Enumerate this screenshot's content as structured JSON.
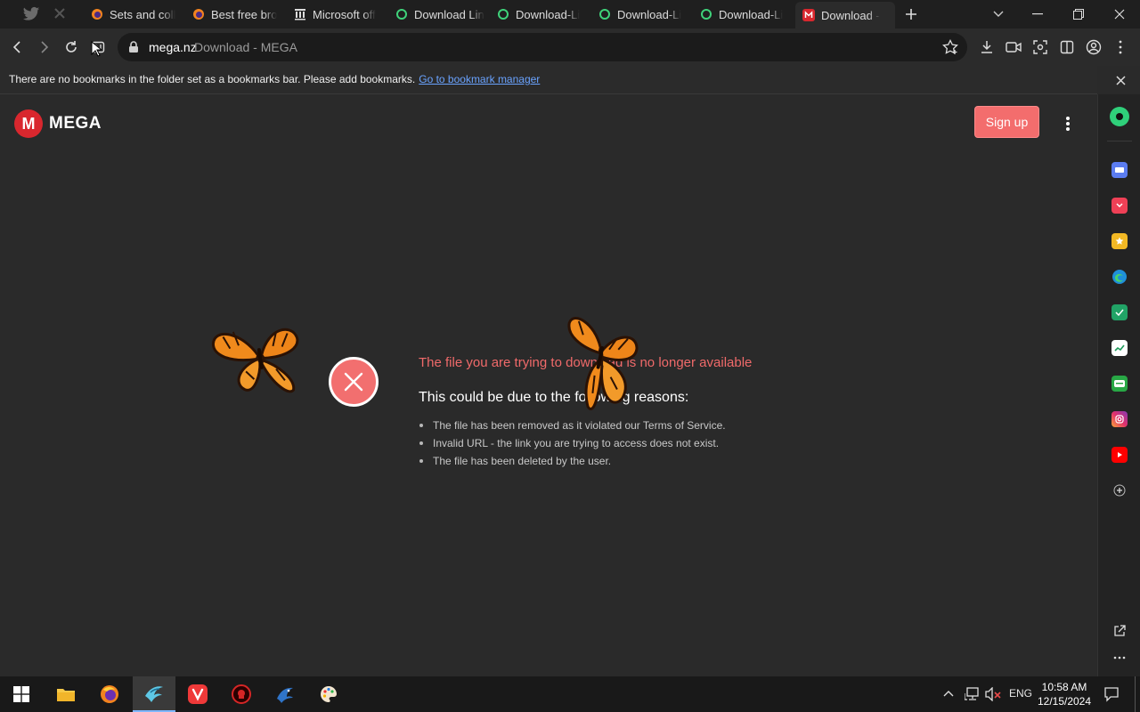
{
  "tabs": [
    {
      "label": "Sets and coll",
      "icon": "firefox-icon"
    },
    {
      "label": "Best free bro",
      "icon": "firefox-icon"
    },
    {
      "label": "Microsoft off",
      "icon": "building-icon"
    },
    {
      "label": "Download Lin",
      "icon": "green-ring-icon"
    },
    {
      "label": "Download-Li",
      "icon": "green-ring-icon"
    },
    {
      "label": "Download-Li",
      "icon": "green-ring-icon"
    },
    {
      "label": "Download-Li",
      "icon": "green-ring-icon"
    },
    {
      "label": "Download - ",
      "icon": "mega-icon",
      "active": true
    }
  ],
  "address": {
    "host": "mega.nz",
    "title": "Download - MEGA"
  },
  "bookmarks_bar": {
    "message": "There are no bookmarks in the folder set as a bookmarks bar. Please add bookmarks.",
    "link": "Go to bookmark manager"
  },
  "page": {
    "logo_letter": "M",
    "logo_text": "MEGA",
    "signup_label": "Sign up",
    "error_title": "The file you are trying to download is no longer available",
    "error_subtitle": "This could be due to the following reasons:",
    "reasons": [
      "The file has been removed as it violated our Terms of Service.",
      "Invalid URL - the link you are trying to access does not exist.",
      "The file has been deleted by the user."
    ]
  },
  "taskbar": {
    "language": "ENG",
    "time": "10:58 AM",
    "date": "12/15/2024"
  },
  "colors": {
    "mega_red": "#d9272e",
    "error_red": "#f06a6a",
    "signup_bg": "#f36d6d"
  }
}
